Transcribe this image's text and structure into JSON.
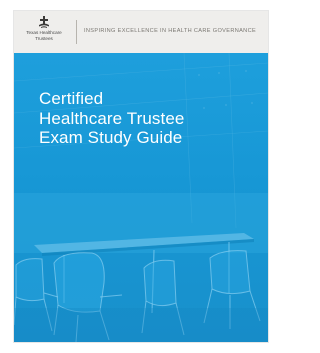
{
  "header": {
    "logo_lines": [
      "Texas Healthcare",
      "Trustees"
    ],
    "tagline": "INSPIRING EXCELLENCE IN HEALTH CARE GOVERNANCE"
  },
  "cover": {
    "title_lines": [
      "Certified",
      "Healthcare Trustee",
      "Exam Study Guide"
    ]
  },
  "colors": {
    "cover_blue": "#1a9ad7",
    "header_bg": "#efeeec",
    "title_text": "#ffffff",
    "tagline_text": "#7a7772"
  },
  "icons": {
    "logo": "texas-healthcare-trustees-logo-icon"
  }
}
